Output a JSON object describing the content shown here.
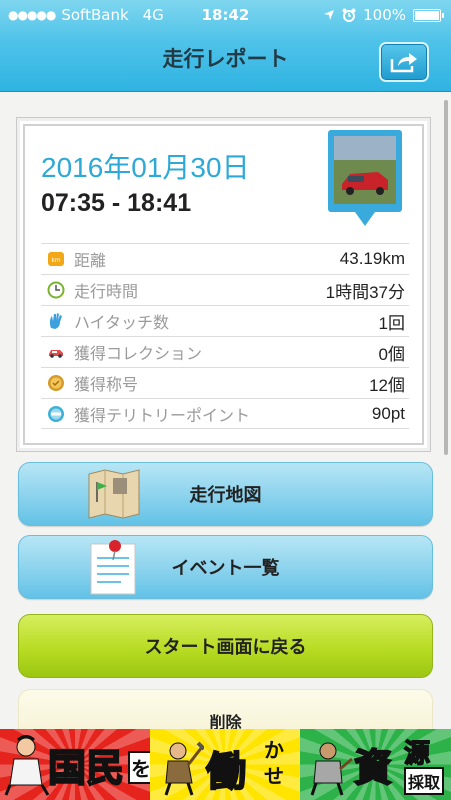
{
  "status_bar": {
    "carrier": "SoftBank",
    "network": "4G",
    "time": "18:42",
    "battery": "100%",
    "battery_level": 1.0
  },
  "nav": {
    "title": "走行レポート",
    "share_icon": "share-icon"
  },
  "report": {
    "date": "2016年01月30日",
    "time_range": "07:35 - 18:41",
    "stats": [
      {
        "icon": "km-icon",
        "label": "距離",
        "value": "43.19km"
      },
      {
        "icon": "clock-icon",
        "label": "走行時間",
        "value": "1時間37分"
      },
      {
        "icon": "high-five-icon",
        "label": "ハイタッチ数",
        "value": "1回"
      },
      {
        "icon": "car-icon",
        "label": "獲得コレクション",
        "value": "0個"
      },
      {
        "icon": "medal-icon",
        "label": "獲得称号",
        "value": "12個"
      },
      {
        "icon": "badge-icon",
        "label": "獲得テリトリーポイント",
        "value": "90pt"
      }
    ]
  },
  "buttons": {
    "map": "走行地図",
    "events": "イベント一覧",
    "back_to_start": "スタート画面に戻る",
    "delete": "削除"
  },
  "ad": {
    "text1": "国民",
    "text2": "を",
    "text3": "働",
    "text4": "かせ",
    "text5": "資",
    "text6": "源",
    "text7": "採取"
  },
  "colors": {
    "accent": "#2ea9d7",
    "nav_bg": "#4fc3e9",
    "button_blue": "#8fd4ee",
    "button_green": "#b8dc23"
  }
}
